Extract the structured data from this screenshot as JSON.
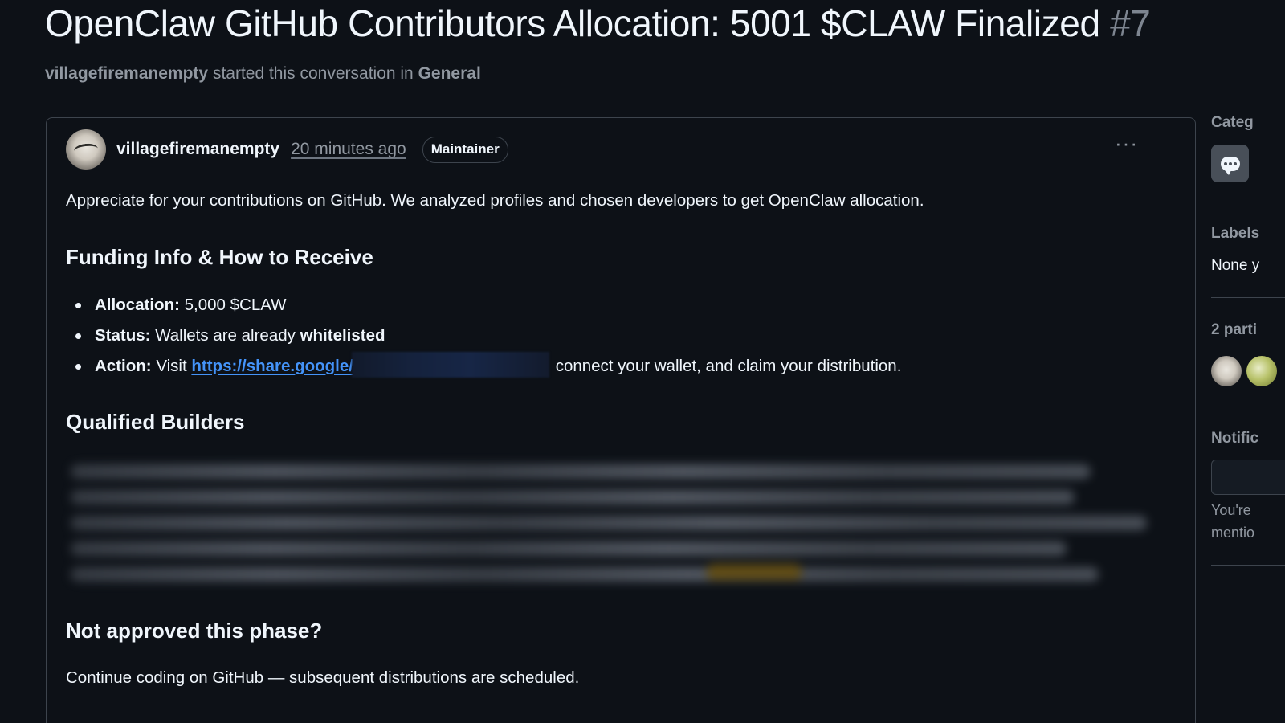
{
  "discussion": {
    "title": "OpenClaw GitHub Contributors Allocation: 5001 $CLAW Finalized",
    "number": "#7",
    "started_by": "villagefiremanempty",
    "started_text": "started this conversation in",
    "category": "General"
  },
  "post": {
    "author": "villagefiremanempty",
    "time": "20 minutes ago",
    "badge": "Maintainer",
    "menu_label": "···",
    "intro": "Appreciate for your contributions on GitHub. We analyzed profiles and chosen developers to get OpenClaw allocation.",
    "funding_heading": "Funding Info & How to Receive",
    "items": {
      "allocation_label": "Allocation:",
      "allocation_value": "5,000 $CLAW",
      "status_label": "Status:",
      "status_value": "Wallets are already",
      "status_bold": "whitelisted",
      "action_label": "Action:",
      "action_prefix": "Visit",
      "action_link": "https://share.google/",
      "action_suffix": "connect your wallet, and claim your distribution."
    },
    "builders_heading": "Qualified Builders",
    "not_approved_heading": "Not approved this phase?",
    "closing": "Continue coding on GitHub — subsequent distributions are scheduled."
  },
  "sidebar": {
    "category_label": "Categ",
    "labels_label": "Labels",
    "labels_value": "None y",
    "participants_label": "2 parti",
    "notifications_label": "Notific",
    "notifications_line1": "You're",
    "notifications_line2": "mentio"
  },
  "icons": {
    "category": "discussion-bubble-icon",
    "menu": "kebab-menu-icon"
  },
  "colors": {
    "background": "#0d1117",
    "link": "#4493f8",
    "muted": "#9198a1",
    "border": "#3d444d"
  }
}
